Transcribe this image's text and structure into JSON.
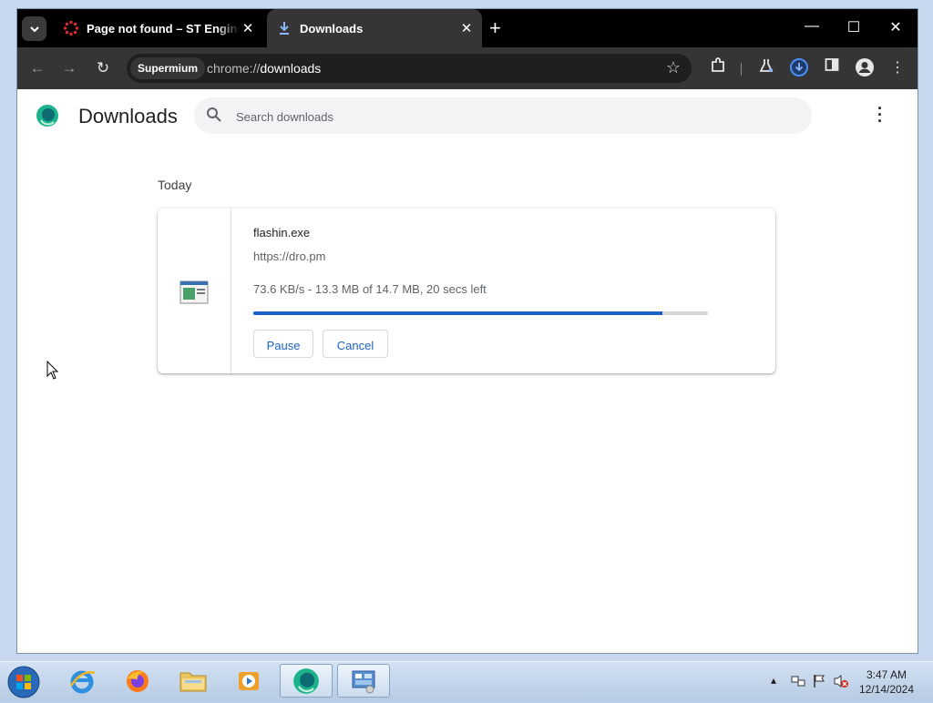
{
  "browser": {
    "tabs": [
      {
        "title": "Page not found – ST Engineering",
        "active": false,
        "favicon": "st-engineering-icon"
      },
      {
        "title": "Downloads",
        "active": true,
        "favicon": "download-icon"
      }
    ],
    "profile_chip": "Supermium",
    "url_scheme": "chrome://",
    "url_host": "downloads"
  },
  "page": {
    "title": "Downloads",
    "search_placeholder": "Search downloads",
    "section_label": "Today",
    "download": {
      "filename": "flashin.exe",
      "source": "https://dro.pm",
      "status": "73.6 KB/s - 13.3 MB of 14.7 MB, 20 secs left",
      "progress": 0.9,
      "pause_label": "Pause",
      "cancel_label": "Cancel"
    }
  },
  "taskbar": {
    "apps": [
      "internet-explorer-icon",
      "firefox-icon",
      "file-explorer-icon",
      "media-player-icon",
      "supermium-icon",
      "control-panel-icon"
    ],
    "time": "3:47 AM",
    "date": "12/14/2024"
  },
  "colors": {
    "accent": "#1a62c6",
    "progress_track": "#d5d7db",
    "tab_active": "#353535"
  }
}
